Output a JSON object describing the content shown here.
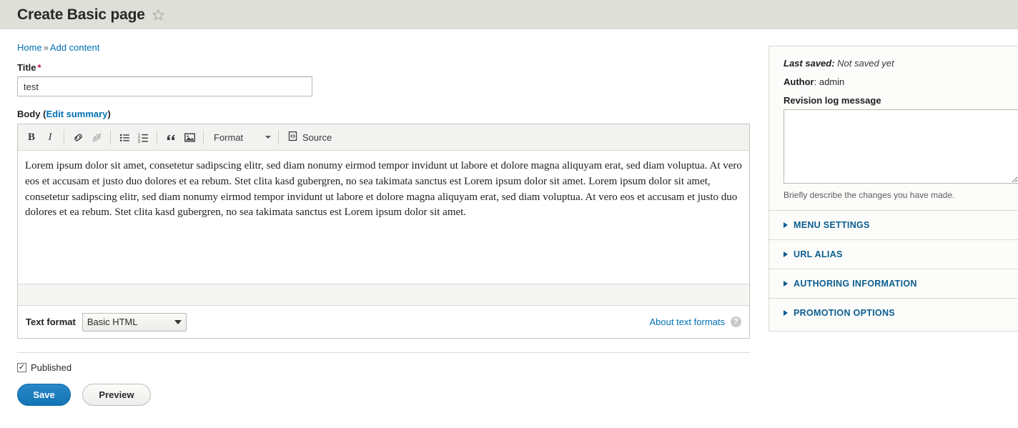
{
  "header": {
    "title": "Create Basic page",
    "star_icon": "star-outline-icon"
  },
  "breadcrumb": {
    "home": "Home",
    "separator": "»",
    "current": "Add content"
  },
  "form": {
    "title_field": {
      "label": "Title",
      "required_mark": "*",
      "value": "test"
    },
    "body_field": {
      "label": "Body",
      "edit_summary_link": "Edit summary",
      "open_paren": "(",
      "close_paren": ")",
      "content": "Lorem ipsum dolor sit amet, consetetur sadipscing elitr, sed diam nonumy eirmod tempor invidunt ut labore et dolore magna aliquyam erat, sed diam voluptua. At vero eos et accusam et justo duo dolores et ea rebum. Stet clita kasd gubergren, no sea takimata sanctus est Lorem ipsum dolor sit amet. Lorem ipsum dolor sit amet, consetetur sadipscing elitr, sed diam nonumy eirmod tempor invidunt ut labore et dolore magna aliquyam erat, sed diam voluptua. At vero eos et accusam et justo duo dolores et ea rebum. Stet clita kasd gubergren, no sea takimata sanctus est Lorem ipsum dolor sit amet."
    },
    "toolbar": {
      "bold": "B",
      "italic": "I",
      "link_icon": "link-icon",
      "unlink_icon": "unlink-icon",
      "bulleted_list_icon": "bulleted-list-icon",
      "numbered_list_icon": "numbered-list-icon",
      "blockquote_icon": "blockquote-icon",
      "image_icon": "image-icon",
      "format_label": "Format",
      "source_label": "Source",
      "source_icon": "source-code-icon"
    },
    "text_format": {
      "label": "Text format",
      "selected": "Basic HTML",
      "about_link": "About text formats",
      "help_icon": "?"
    },
    "published": {
      "label": "Published",
      "checked": true,
      "check_glyph": "✓"
    },
    "buttons": {
      "save": "Save",
      "preview": "Preview"
    }
  },
  "sidebar": {
    "meta": {
      "last_saved_label": "Last saved",
      "last_saved_value": "Not saved yet",
      "author_label": "Author",
      "author_value": "admin",
      "colon": ": ",
      "revision_label": "Revision log message",
      "revision_value": "",
      "revision_help": "Briefly describe the changes you have made."
    },
    "sections": [
      {
        "label": "Menu settings"
      },
      {
        "label": "URL alias"
      },
      {
        "label": "Authoring information"
      },
      {
        "label": "Promotion options"
      }
    ]
  },
  "colors": {
    "header_bg": "#dfdfd9",
    "accent_link": "#0071b3",
    "accent_section": "#0b5d8f",
    "save_button": "#1274b4",
    "required": "#c0143c",
    "sidebar_bg": "#fcfcfa"
  }
}
